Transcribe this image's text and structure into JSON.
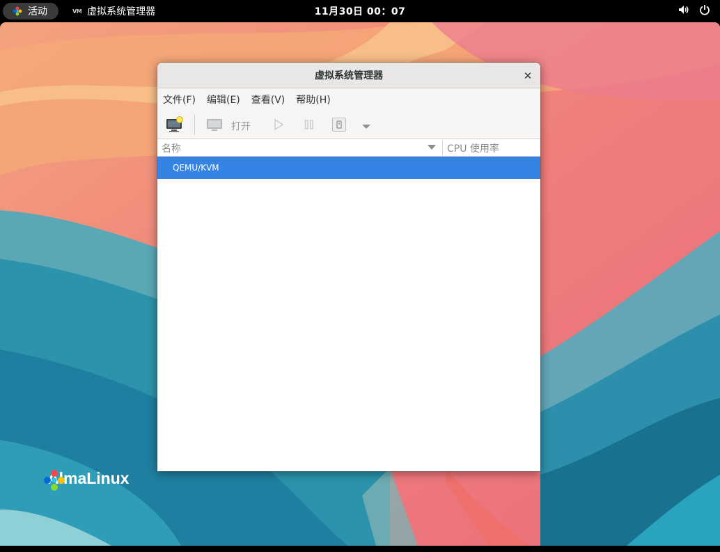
{
  "topbar": {
    "activities_label": "活动",
    "app_label": "虚拟系统管理器",
    "app_icon_text": "VM",
    "clock": "11月30日  00：07",
    "icons": [
      "volume-icon",
      "power-icon"
    ]
  },
  "desktop": {
    "brand": "AlmaLinux"
  },
  "window": {
    "title": "虚拟系统管理器",
    "close_glyph": "✕",
    "menu": [
      "文件(F)",
      "编辑(E)",
      "查看(V)",
      "帮助(H)"
    ],
    "toolbar": {
      "open_label": "打开",
      "icons": [
        "new-vm-icon",
        "console-icon",
        "run-icon",
        "pause-icon",
        "shutdown-icon",
        "shutdown-menu-icon"
      ]
    },
    "columns": [
      "名称",
      "CPU 使用率"
    ],
    "rows": [
      {
        "name": "QEMU/KVM",
        "selected": true
      }
    ]
  },
  "colors": {
    "accent": "#3584e4",
    "topbar": "#000000",
    "window_bg": "#f6f5f4"
  }
}
